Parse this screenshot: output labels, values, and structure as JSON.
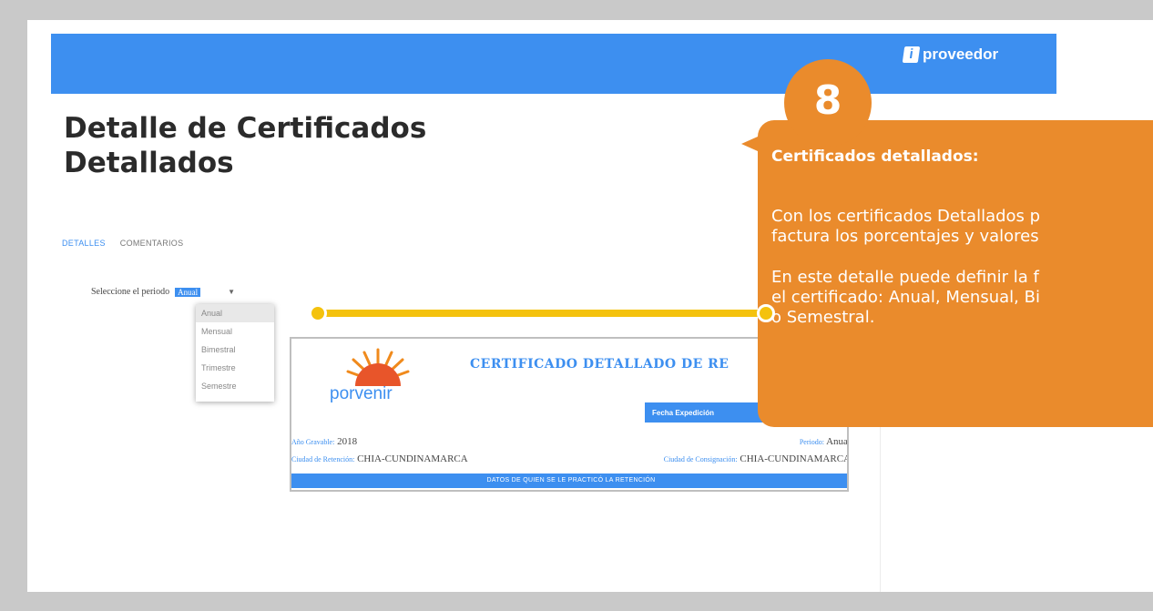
{
  "brand": {
    "icon_letter": "i",
    "name": "proveedor"
  },
  "page": {
    "title": "Detalle de Certificados Detallados"
  },
  "tabs": [
    {
      "label": "DETALLES",
      "active": true
    },
    {
      "label": "COMENTARIOS",
      "active": false
    }
  ],
  "period": {
    "label": "Seleccione el periodo",
    "selected": "Anual",
    "options": [
      "Anual",
      "Mensual",
      "Bimestral",
      "Trimestre",
      "Semestre"
    ]
  },
  "certificate": {
    "title": "CERTIFICADO DETALLADO DE RE",
    "logo_text": "porvenir",
    "logo_sub": "",
    "fecha_label": "Fecha Expedición",
    "year_label": "Año Gravable:",
    "year_value": "2018",
    "periodo_label": "Periodo:",
    "periodo_value": "Anual",
    "ciudad_retencion_label": "Ciudad de Retención:",
    "ciudad_retencion_value": "CHIA-CUNDINAMARCA",
    "ciudad_consignacion_label": "Ciudad de Consignación:",
    "ciudad_consignacion_value": "CHIA-CUNDINAMARCA",
    "section_bar": "DATOS DE QUIEN SE LE PRACTICÓ LA RETENCIÓN"
  },
  "callout": {
    "number": "8",
    "heading": "Certificados detallados:",
    "p1_line1": "Con los certificados Detallados p",
    "p1_line2": "factura los porcentajes y valores",
    "p2_line1": "En este detalle puede definir la f",
    "p2_line2": "el certificado: Anual, Mensual, Bi",
    "p2_line3": "o Semestral."
  },
  "colors": {
    "accent_blue": "#3d8ff0",
    "callout_orange": "#ea8b2c",
    "connector_yellow": "#f4c20d",
    "frame_gray": "#c9c9c9"
  }
}
